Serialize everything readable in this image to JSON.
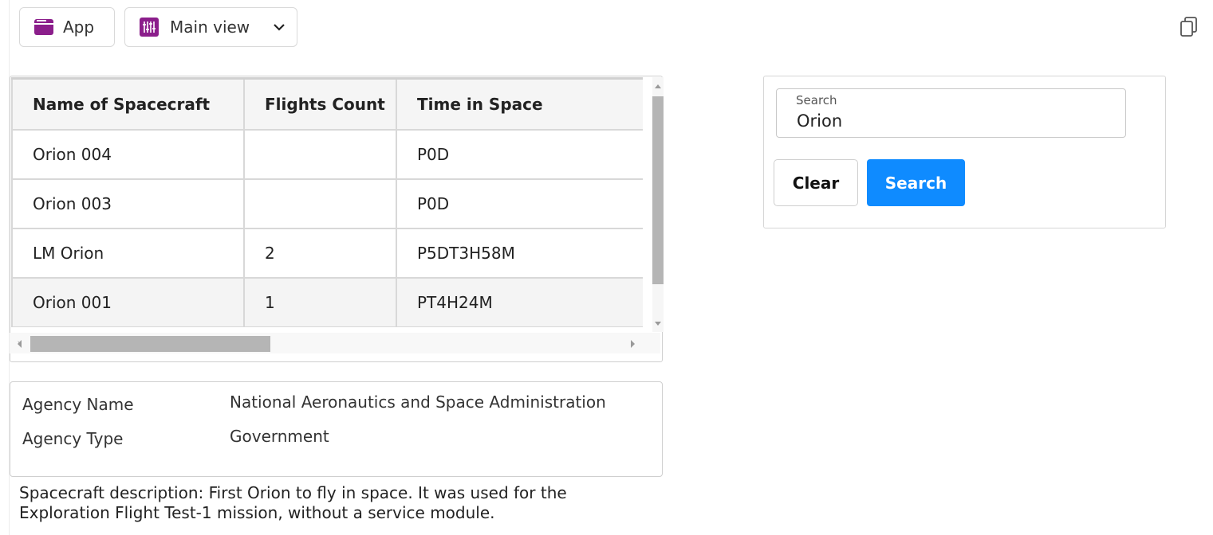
{
  "toolbar": {
    "app_label": "App",
    "view_label": "Main view",
    "icons": {
      "app": "app-window-icon",
      "view": "sliders-icon",
      "dropdown": "chevron-down-icon",
      "copy": "copy-icon"
    },
    "accent_color": "#8b1e8b"
  },
  "table": {
    "columns": [
      "Name of Spacecraft",
      "Flights Count",
      "Time in Space"
    ],
    "rows": [
      {
        "name": "Orion 004",
        "flights": "",
        "time": "P0D"
      },
      {
        "name": "Orion 003",
        "flights": "",
        "time": "P0D"
      },
      {
        "name": "LM Orion",
        "flights": "2",
        "time": "P5DT3H58M"
      },
      {
        "name": "Orion 001",
        "flights": "1",
        "time": "PT4H24M"
      }
    ]
  },
  "details": {
    "agency_name_label": "Agency Name",
    "agency_name_value": "National Aeronautics and Space Administration",
    "agency_type_label": "Agency Type",
    "agency_type_value": "Government"
  },
  "description": "Spacecraft description: First Orion to fly in space. It was used for the Exploration Flight Test-1 mission, without a service module.",
  "search": {
    "label": "Search",
    "value": "Orion",
    "clear_label": "Clear",
    "search_label": "Search",
    "primary_color": "#0f8bff"
  }
}
